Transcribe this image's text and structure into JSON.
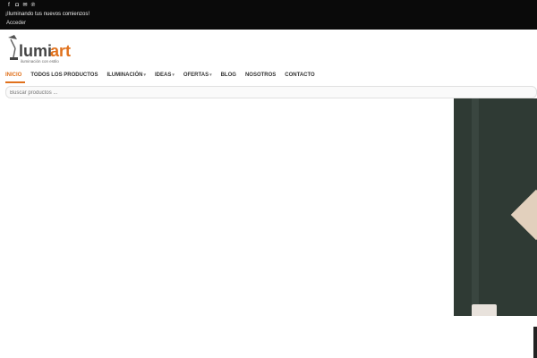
{
  "topbar": {
    "tagline": "¡Iluminando tus nuevos comienzos!",
    "login": "Acceder",
    "social_icons": [
      "facebook-icon",
      "instagram-icon",
      "email-icon",
      "pinterest-icon"
    ]
  },
  "brand": {
    "name_prefix": "lumi",
    "name_suffix": "art",
    "slogan": "iluminación con estilo",
    "accent_color": "#e0711c"
  },
  "nav": {
    "items": [
      {
        "label": "INICIO",
        "active": true
      },
      {
        "label": "TODOS LOS PRODUCTOS"
      },
      {
        "label": "ILUMINACIÓN",
        "dropdown": true
      },
      {
        "label": "IDEAS",
        "dropdown": true
      },
      {
        "label": "OFERTAS",
        "dropdown": true
      },
      {
        "label": "BLOG"
      },
      {
        "label": "NOSOTROS"
      },
      {
        "label": "CONTACTO"
      }
    ]
  },
  "search": {
    "placeholder": "Buscar productos ..."
  }
}
